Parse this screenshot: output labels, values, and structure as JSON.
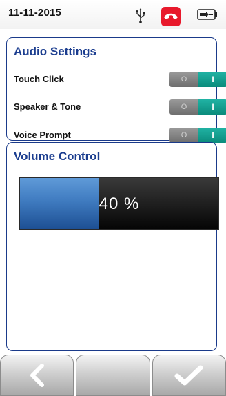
{
  "status_bar": {
    "date": "11-11-2015",
    "icons": [
      "usb-icon",
      "phone-hangup-icon",
      "battery-icon"
    ],
    "phone_color": "#e8192c"
  },
  "audio_settings": {
    "title": "Audio Settings",
    "items": [
      {
        "label": "Touch Click",
        "state": "on",
        "off_label": "O",
        "on_label": "I"
      },
      {
        "label": "Speaker & Tone",
        "state": "on",
        "off_label": "O",
        "on_label": "I"
      },
      {
        "label": "Voice Prompt",
        "state": "on",
        "off_label": "O",
        "on_label": "I"
      }
    ],
    "toggle_on_color": "#0f9a8b"
  },
  "volume_control": {
    "title": "Volume Control",
    "value": 40,
    "label": "40 %",
    "fill_color": "#3f7bc0"
  },
  "bottom_nav": {
    "buttons": [
      "back-icon",
      "blank",
      "checkmark-icon"
    ]
  },
  "colors": {
    "accent": "#1b3d8f"
  }
}
